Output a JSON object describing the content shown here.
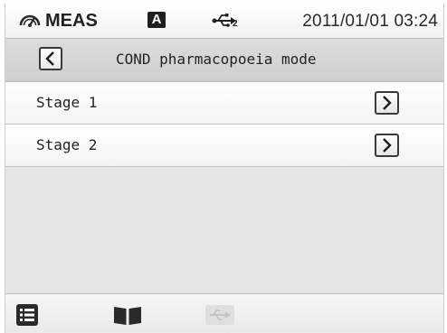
{
  "status_bar": {
    "mode_icon": "meas-gauge-icon",
    "mode_label": "MEAS",
    "auto_badge": "A",
    "usb_icon": "usb-icon",
    "usb_subscript": "2",
    "datetime": "2011/01/01 03:24"
  },
  "header": {
    "back_icon": "chevron-left-icon",
    "title": "COND pharmacopoeia mode"
  },
  "list": {
    "items": [
      {
        "label": "Stage 1",
        "icon": "chevron-right-icon"
      },
      {
        "label": "Stage 2",
        "icon": "chevron-right-icon"
      }
    ]
  },
  "toolbar": {
    "items": [
      {
        "icon": "menu-list-icon",
        "enabled": true
      },
      {
        "icon": "manual-book-icon",
        "enabled": true
      },
      {
        "icon": "usb-icon",
        "enabled": false
      }
    ]
  },
  "colors": {
    "background": "#e5e5e5",
    "header": "#d4d4d4",
    "icon": "#2a2a2a",
    "disabled_icon": "#c8c8c8"
  }
}
